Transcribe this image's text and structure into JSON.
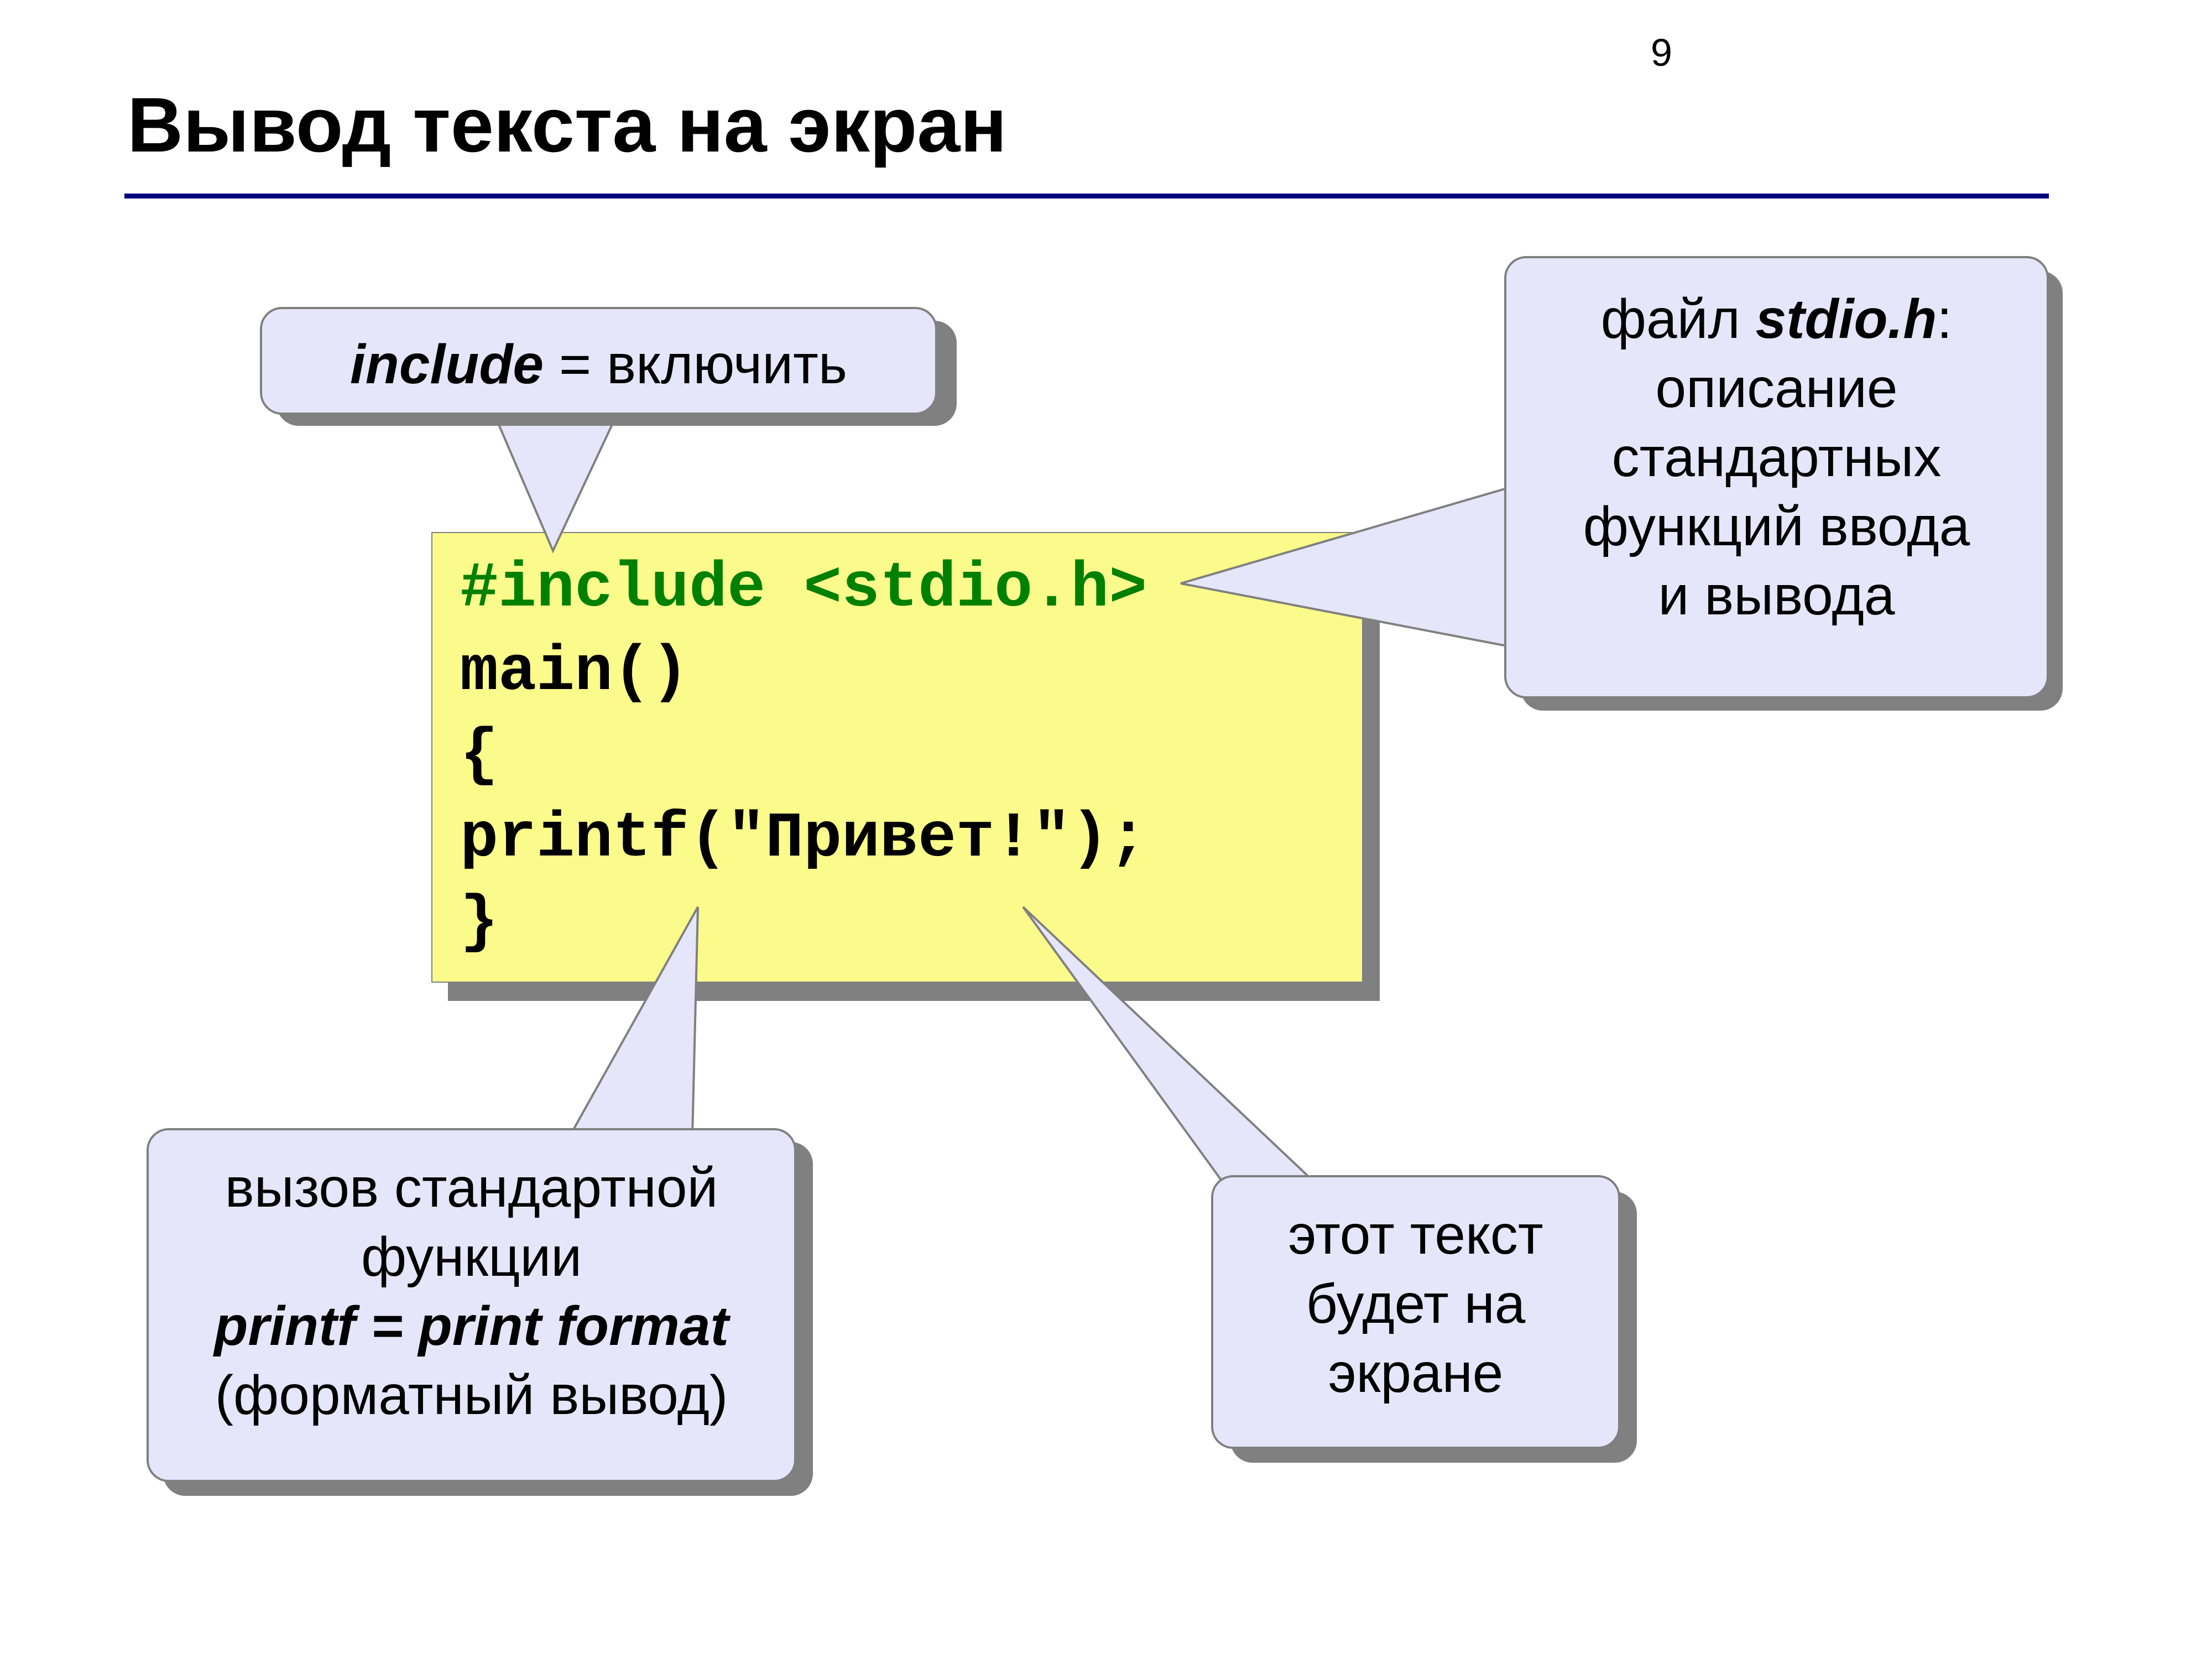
{
  "pageNumber": "9",
  "title": "Вывод текста на экран",
  "code": {
    "line1": "#include <stdio.h>",
    "line2": "main()",
    "line3": "{",
    "line4": "printf(\"Привет!\");",
    "line5": "}"
  },
  "callouts": {
    "include": {
      "word": "include",
      "rest": " = включить"
    },
    "stdio": {
      "l1a": "файл ",
      "l1b": "stdio.h",
      "l1c": ":",
      "l2": "описание",
      "l3": "стандартных",
      "l4": "функций ввода",
      "l5": "и вывода"
    },
    "printf": {
      "l1": "вызов стандартной",
      "l2": "функции",
      "l3": "printf = print format",
      "l4": "(форматный вывод)"
    },
    "screenText": {
      "l1": "этот текст",
      "l2": "будет на",
      "l3": "экране"
    }
  }
}
